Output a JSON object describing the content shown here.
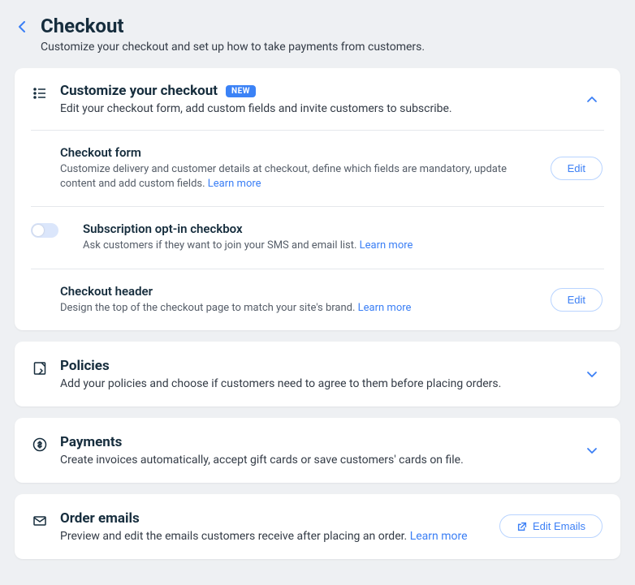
{
  "page": {
    "title": "Checkout",
    "subtitle": "Customize your checkout and set up how to take payments from customers."
  },
  "sections": {
    "customize": {
      "title": "Customize your checkout",
      "badge": "NEW",
      "desc": "Edit your checkout form, add custom fields and invite customers to subscribe.",
      "items": {
        "form": {
          "title": "Checkout form",
          "desc": "Customize delivery and customer details at checkout, define which fields are mandatory, update content and add custom fields. ",
          "learn": "Learn more",
          "button": "Edit"
        },
        "subscription": {
          "title": "Subscription opt-in checkbox",
          "desc": "Ask customers if they want to join your SMS and email list. ",
          "learn": "Learn more"
        },
        "header": {
          "title": "Checkout header",
          "desc": "Design the top of the checkout page to match your site's brand. ",
          "learn": "Learn more",
          "button": "Edit"
        }
      }
    },
    "policies": {
      "title": "Policies",
      "desc": "Add your policies and choose if customers need to agree to them before placing orders."
    },
    "payments": {
      "title": "Payments",
      "desc": "Create invoices automatically, accept gift cards or save customers' cards on file."
    },
    "emails": {
      "title": "Order emails",
      "desc": "Preview and edit the emails customers receive after placing an order. ",
      "learn": "Learn more",
      "button": "Edit Emails"
    }
  }
}
